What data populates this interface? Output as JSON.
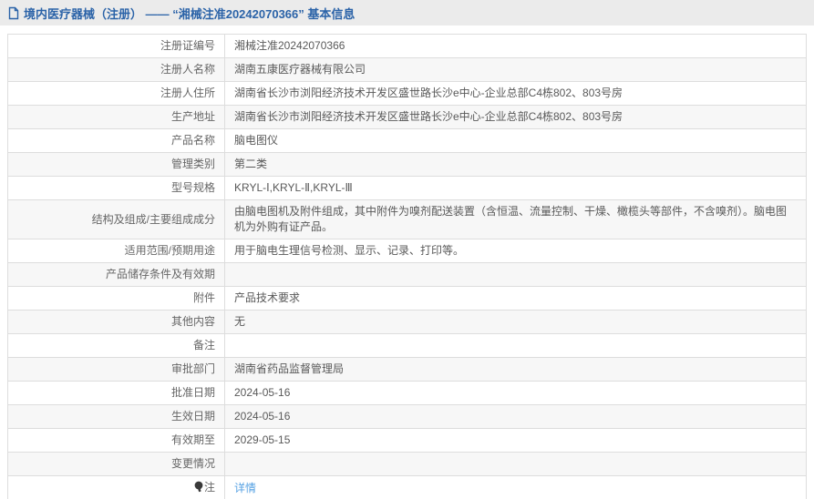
{
  "header": {
    "icon": "document-icon",
    "title": "境内医疗器械（注册） —— “湘械注准20242070366” 基本信息"
  },
  "colors": {
    "header_bg": "#ebebeb",
    "header_text": "#2b63a8",
    "link": "#55a1e3",
    "row_alt_bg": "#f7f7f7",
    "border_outer": "#c3c3c3",
    "border_inner": "#dddddd",
    "label_text": "#666666",
    "value_text": "#595959"
  },
  "table": {
    "rows": [
      {
        "label": "注册证编号",
        "value": "湘械注准20242070366"
      },
      {
        "label": "注册人名称",
        "value": "湖南五康医疗器械有限公司"
      },
      {
        "label": "注册人住所",
        "value": "湖南省长沙市浏阳经济技术开发区盛世路长沙e中心-企业总部C4栋802、803号房"
      },
      {
        "label": "生产地址",
        "value": "湖南省长沙市浏阳经济技术开发区盛世路长沙e中心-企业总部C4栋802、803号房"
      },
      {
        "label": "产品名称",
        "value": "脑电图仪"
      },
      {
        "label": "管理类别",
        "value": "第二类"
      },
      {
        "label": "型号规格",
        "value": "KRYL-Ⅰ,KRYL-Ⅱ,KRYL-Ⅲ"
      },
      {
        "label": "结构及组成/主要组成成分",
        "value": "由脑电图机及附件组成，其中附件为嗅剂配送装置（含恒温、流量控制、干燥、橄榄头等部件，不含嗅剂）。脑电图机为外购有证产品。"
      },
      {
        "label": "适用范围/预期用途",
        "value": "用于脑电生理信号检测、显示、记录、打印等。"
      },
      {
        "label": "产品储存条件及有效期",
        "value": ""
      },
      {
        "label": "附件",
        "value": "产品技术要求"
      },
      {
        "label": "其他内容",
        "value": "无"
      },
      {
        "label": "备注",
        "value": ""
      },
      {
        "label": "审批部门",
        "value": "湖南省药品监督管理局"
      },
      {
        "label": "批准日期",
        "value": "2024-05-16"
      },
      {
        "label": "生效日期",
        "value": "2024-05-16"
      },
      {
        "label": "有效期至",
        "value": "2029-05-15"
      },
      {
        "label": "变更情况",
        "value": ""
      },
      {
        "label": "注",
        "label_icon": "lightbulb-icon",
        "value": "详情",
        "value_type": "link"
      }
    ]
  }
}
